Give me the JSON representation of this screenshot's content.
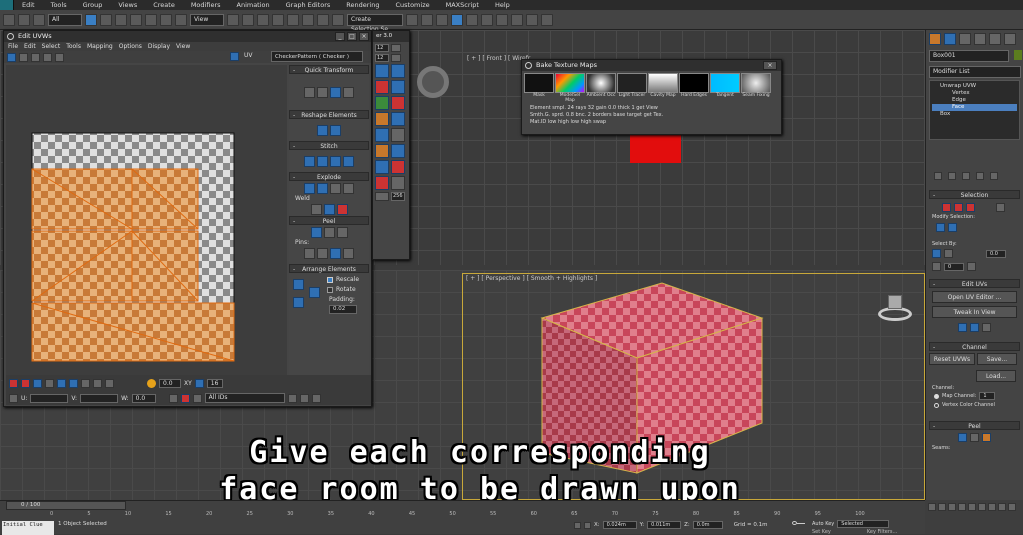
{
  "menubar": {
    "items": [
      "Edit",
      "Tools",
      "Group",
      "Views",
      "Create",
      "Modifiers",
      "Animation",
      "Graph Editors",
      "Rendering",
      "Customize",
      "MAXScript",
      "Help"
    ]
  },
  "toolbar": {
    "filter_selected": "All",
    "refcoord_selected": "View",
    "selection_set": "Create Selection Se"
  },
  "edit_uvw": {
    "title": "Edit UVWs",
    "menu": [
      "File",
      "Edit",
      "Select",
      "Tools",
      "Mapping",
      "Options",
      "Display",
      "View"
    ],
    "uv_label": "UV",
    "checker_pattern": "CheckerPattern  ( Checker )",
    "quick_transform": "Quick Transform",
    "reshape": "Reshape Elements",
    "stitch": "Stitch",
    "explode": "Explode",
    "weld": "Weld",
    "peel": "Peel",
    "pins": "Pins:",
    "arrange": "Arrange Elements",
    "rescale": "Rescale",
    "rotate": "Rotate",
    "padding_label": "Padding:",
    "padding_value": "0.02",
    "bottom_value": "0.0",
    "xy_label": "XY",
    "num16": "16",
    "u_label": "U:",
    "v_label": "V:",
    "w_label": "W:",
    "w_value": "0.0",
    "all_ids": "All IDs"
  },
  "bake": {
    "title": "Bake Texture Maps",
    "columns": [
      "Mask",
      "ModelSel Map",
      "Ambient Occ",
      "Light Tracer",
      "Cavity Map",
      "Hard Edges",
      "Tangent",
      "Seam Fixing"
    ],
    "row1": [
      "Element",
      "smpl.",
      "24",
      "rays",
      "32",
      "gain",
      "0.0",
      "thick",
      "1",
      "get View"
    ],
    "row2": [
      "Smth.G.",
      "sprd.",
      "0.8",
      "bnc.",
      "2",
      "borders",
      "base",
      "target",
      "get Tex."
    ],
    "row3": [
      "Mat.ID",
      "low",
      "high",
      "low",
      "high",
      "swap"
    ]
  },
  "mini_toolbar": {
    "title": "er 3.0",
    "values": [
      "12",
      "12"
    ],
    "badge": "256"
  },
  "viewports": {
    "front_label": "[ + ] [ Front ] [ Wirefr",
    "persp_label": "[ + ] [ Perspective ] [ Smooth + Highlights ]"
  },
  "caption": {
    "line1": "Give each corresponding",
    "line2": "face room to be drawn upon"
  },
  "command_panel": {
    "object_name": "Box001",
    "modifier_list": "Modifier List",
    "stack": [
      "Unwrap UVW",
      "Vertex",
      "Edge",
      "Face",
      "Box"
    ],
    "selected_stack": "Face",
    "selection": "Selection",
    "modify_selection": "Modify Selection:",
    "select_by": "Select By:",
    "sel_value1": "0.0",
    "sel_value2": "0",
    "edit_uvs": "Edit UVs",
    "open_uv_editor": "Open UV Editor ...",
    "tweak_in_view": "Tweak In View",
    "channel": "Channel",
    "reset_uvws": "Reset UVWs",
    "save": "Save...",
    "load": "Load...",
    "channel_label": "Channel:",
    "map_channel": "Map Channel:",
    "map_channel_value": "1",
    "vertex_color_channel": "Vertex Color Channel",
    "peel": "Peel",
    "seams": "Seams:"
  },
  "timeline": {
    "frame": "0 / 100",
    "ticks": [
      "0",
      "5",
      "10",
      "15",
      "20",
      "25",
      "30",
      "35",
      "40",
      "45",
      "50",
      "55",
      "60",
      "65",
      "70",
      "75",
      "80",
      "85",
      "90",
      "95",
      "100"
    ]
  },
  "status": {
    "script_label": "Initial Clue",
    "objects_selected": "1 Object Selected",
    "x_label": "X:",
    "x_value": "0.024m",
    "y_label": "Y:",
    "y_value": "0.011m",
    "z_label": "Z:",
    "z_value": "0.0m",
    "grid": "Grid = 0.1m",
    "autokey": "Auto Key",
    "autokey_value": "Selected",
    "setkey": "Set Key",
    "key_filters": "Key Filters..."
  }
}
